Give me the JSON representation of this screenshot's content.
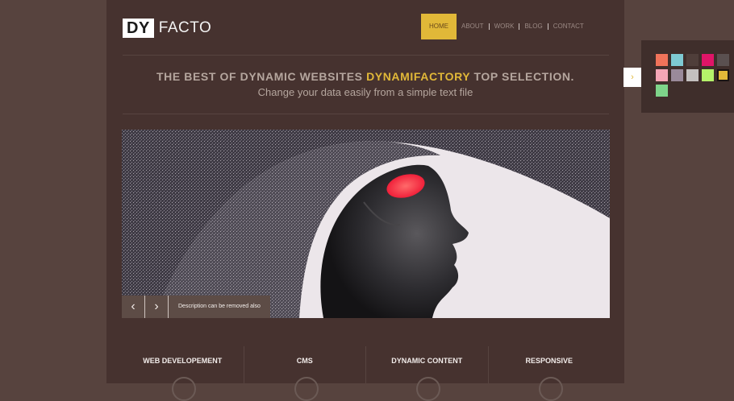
{
  "logo": {
    "box": "DY",
    "text": "FACTO"
  },
  "nav": {
    "items": [
      "HOME",
      "ABOUT",
      "WORK",
      "BLOG",
      "CONTACT"
    ],
    "active": "HOME"
  },
  "hero": {
    "tagline_before": "THE BEST OF DYNAMIC WEBSITES ",
    "tagline_highlight": "DYNAMIFACTORY",
    "tagline_after": " TOP SELECTION.",
    "subline": "Change your data easily from a simple text file"
  },
  "slider": {
    "prev_icon": "‹",
    "next_icon": "›",
    "caption": "Description can be removed also"
  },
  "features": [
    "WEB DEVELOPEMENT",
    "CMS",
    "DYNAMIC CONTENT",
    "RESPONSIVE"
  ],
  "palette": {
    "toggle_icon": "›",
    "swatches": [
      "#f0735a",
      "#7ecad3",
      "#4f3e3a",
      "#e01568",
      "#5a5050",
      "#f4a6b6",
      "#9a8a9a",
      "#c4c0bf",
      "#b5f26a",
      "#e1b838",
      "#7ed48a"
    ],
    "selected": "#e1b838"
  },
  "colors": {
    "accent": "#e1b838",
    "page_bg": "#46322f",
    "outer_bg": "#57433e"
  }
}
